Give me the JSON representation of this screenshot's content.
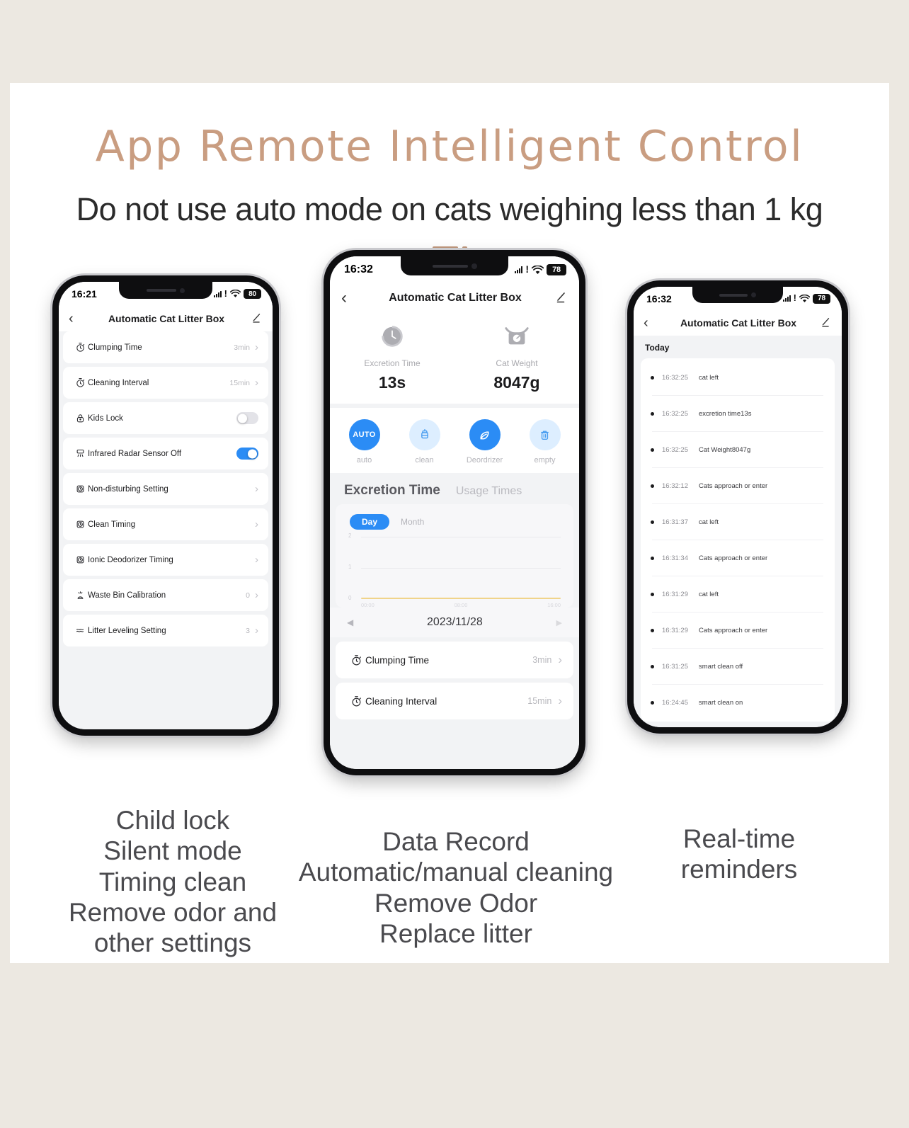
{
  "header": {
    "title": "App Remote Intelligent Control",
    "subtitle": "Do not use auto mode on cats weighing less than 1 kg"
  },
  "phone_left": {
    "status": {
      "time": "16:21",
      "battery": "80"
    },
    "nav": {
      "title": "Automatic Cat Litter Box",
      "back_icon": "chevron-left-icon",
      "edit_icon": "pencil-icon"
    },
    "rows": [
      {
        "icon": "stopwatch-icon",
        "label": "Clumping Time",
        "value": "3min",
        "type": "link"
      },
      {
        "icon": "stopwatch-icon",
        "label": "Cleaning Interval",
        "value": "15min",
        "type": "link"
      },
      {
        "icon": "lock-icon",
        "label": "Kids Lock",
        "value": "",
        "type": "toggle-off"
      },
      {
        "icon": "radar-sensor-icon",
        "label": "Infrared Radar Sensor Off",
        "value": "",
        "type": "toggle-on"
      },
      {
        "icon": "alarm-clock-icon",
        "label": "Non-disturbing Setting",
        "value": "",
        "type": "link"
      },
      {
        "icon": "alarm-clock-icon",
        "label": "Clean Timing",
        "value": "",
        "type": "link"
      },
      {
        "icon": "alarm-clock-icon",
        "label": "Ionic Deodorizer Timing",
        "value": "",
        "type": "link"
      },
      {
        "icon": "bin-calibration-icon",
        "label": "Waste Bin Calibration",
        "value": "0",
        "type": "link"
      },
      {
        "icon": "litter-level-icon",
        "label": "Litter Leveling Setting",
        "value": "3",
        "type": "link"
      }
    ],
    "caption": "Child lock\nSilent mode\nTiming clean\nRemove odor and\nother settings"
  },
  "phone_center": {
    "status": {
      "time": "16:32",
      "battery": "78"
    },
    "nav": {
      "title": "Automatic Cat Litter Box",
      "back_icon": "chevron-left-icon",
      "edit_icon": "pencil-icon"
    },
    "stats": [
      {
        "icon": "timer-dial-icon",
        "label": "Excretion Time",
        "value": "13s"
      },
      {
        "icon": "scale-icon",
        "label": "Cat Weight",
        "value": "8047g"
      }
    ],
    "actions": [
      {
        "icon": "auto-text-icon",
        "glyph": "AUTO",
        "label": "auto",
        "state": "solid"
      },
      {
        "icon": "clean-scoop-icon",
        "glyph": "",
        "label": "clean",
        "state": "light"
      },
      {
        "icon": "leaf-deodorizer-icon",
        "glyph": "",
        "label": "Deordrizer",
        "state": "solid"
      },
      {
        "icon": "trash-empty-icon",
        "glyph": "",
        "label": "empty",
        "state": "light"
      }
    ],
    "tabs": [
      {
        "label": "Excretion Time",
        "active": true
      },
      {
        "label": "Usage Times",
        "active": false
      }
    ],
    "segment": [
      {
        "label": "Day",
        "active": true
      },
      {
        "label": "Month",
        "active": false
      }
    ],
    "date": {
      "value": "2023/11/28",
      "prev_icon": "caret-left-icon",
      "next_icon": "caret-right-icon"
    },
    "rows": [
      {
        "icon": "stopwatch-icon",
        "label": "Clumping Time",
        "value": "3min"
      },
      {
        "icon": "stopwatch-icon",
        "label": "Cleaning Interval",
        "value": "15min"
      }
    ],
    "caption": "Data Record\nAutomatic/manual cleaning\nRemove Odor\nReplace litter"
  },
  "phone_right": {
    "status": {
      "time": "16:32",
      "battery": "78"
    },
    "nav": {
      "title": "Automatic Cat Litter Box",
      "back_icon": "chevron-left-icon",
      "edit_icon": "pencil-icon"
    },
    "section_label": "Today",
    "logs": [
      {
        "time": "16:32:25",
        "message": "cat left"
      },
      {
        "time": "16:32:25",
        "message": "excretion time13s"
      },
      {
        "time": "16:32:25",
        "message": "Cat Weight8047g"
      },
      {
        "time": "16:32:12",
        "message": "Cats approach or enter"
      },
      {
        "time": "16:31:37",
        "message": "cat left"
      },
      {
        "time": "16:31:34",
        "message": "Cats approach or enter"
      },
      {
        "time": "16:31:29",
        "message": "cat left"
      },
      {
        "time": "16:31:29",
        "message": "Cats approach or enter"
      },
      {
        "time": "16:31:25",
        "message": "smart clean off"
      },
      {
        "time": "16:24:45",
        "message": "smart clean on"
      }
    ],
    "caption": "Real-time\nreminders"
  },
  "chart_data": {
    "type": "line",
    "title": "Excretion Time",
    "xlabel": "",
    "ylabel": "",
    "x": [
      "00:00",
      "08:00",
      "16:00"
    ],
    "values": [
      0,
      0,
      0
    ],
    "yticks": [
      2,
      1,
      0
    ],
    "ylim": [
      0,
      2
    ],
    "grid": true,
    "legend": "none",
    "series": [
      {
        "name": "Excretion Time",
        "values": [
          0,
          0,
          0
        ],
        "color": "#f0d48a"
      }
    ]
  },
  "colors": {
    "page_bg": "#ece8e1",
    "card_bg": "#ffffff",
    "title": "#c99d81",
    "accent_blue": "#2b8cf5",
    "accent_blue_light": "#ddeeff",
    "chart_line": "#f0d48a"
  }
}
